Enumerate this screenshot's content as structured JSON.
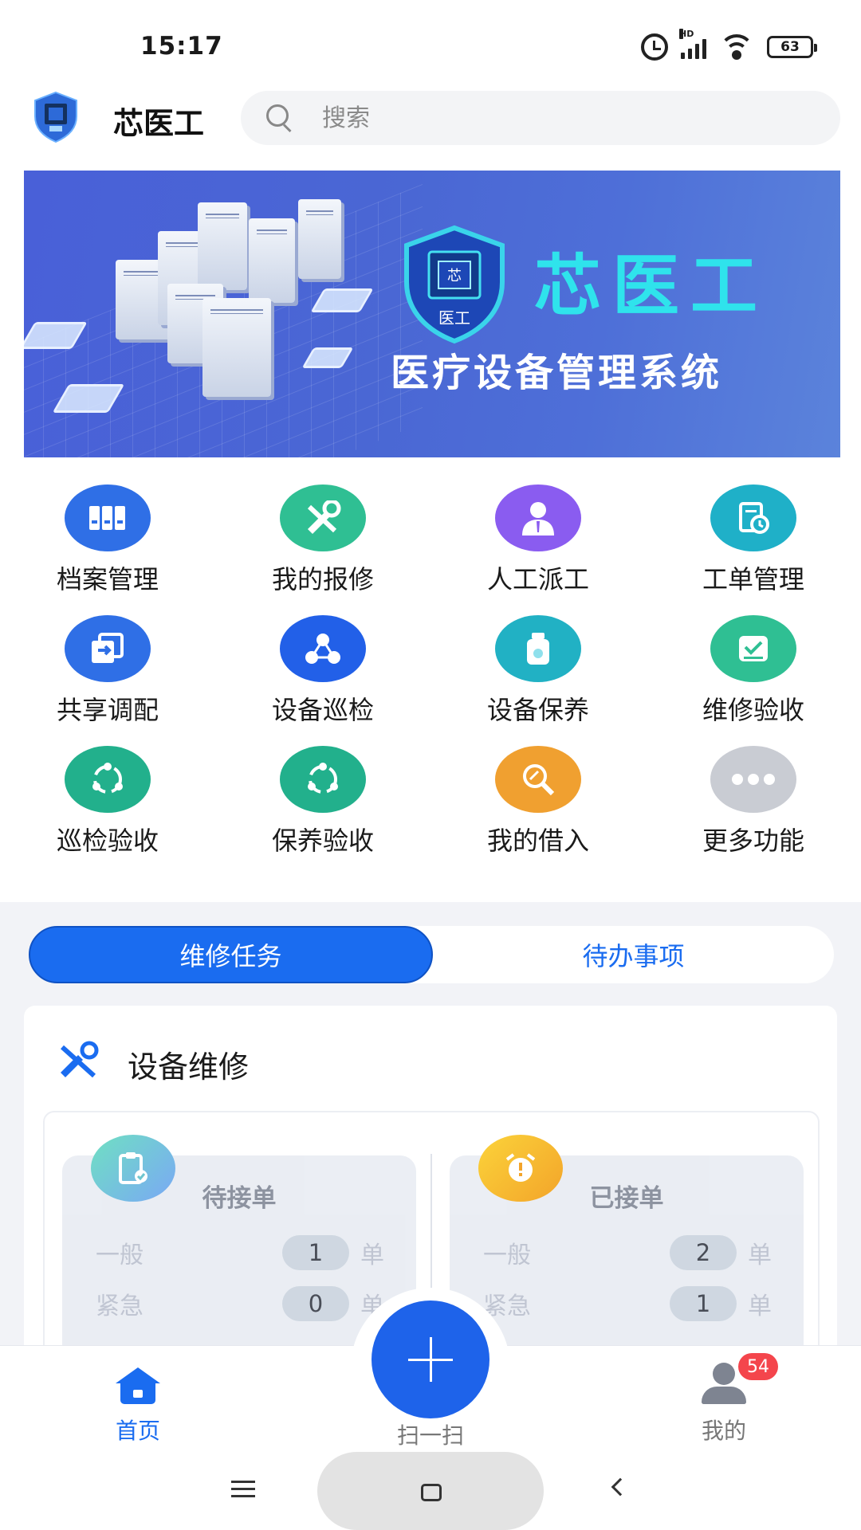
{
  "status_bar": {
    "time": "15:17",
    "battery": "63",
    "network": "HD"
  },
  "header": {
    "app_title": "芯医工",
    "search_placeholder": "搜索"
  },
  "banner": {
    "title": "芯医工",
    "subtitle": "医疗设备管理系统",
    "logo_char": "芯",
    "logo_text": "医工"
  },
  "features": [
    {
      "label": "档案管理",
      "icon": "archive-icon",
      "color": "#2f6fe6"
    },
    {
      "label": "我的报修",
      "icon": "tools-icon",
      "color": "#2fbf93"
    },
    {
      "label": "人工派工",
      "icon": "person-icon",
      "color": "#8a5cf0"
    },
    {
      "label": "工单管理",
      "icon": "work-order-icon",
      "color": "#1fb0c8"
    },
    {
      "label": "共享调配",
      "icon": "share-icon",
      "color": "#2f6fe6"
    },
    {
      "label": "设备巡检",
      "icon": "network-icon",
      "color": "#2260e8"
    },
    {
      "label": "设备保养",
      "icon": "bottle-icon",
      "color": "#21b1c4"
    },
    {
      "label": "维修验收",
      "icon": "check-icon",
      "color": "#2fbf93"
    },
    {
      "label": "巡检验收",
      "icon": "cycle-icon",
      "color": "#22b08c"
    },
    {
      "label": "保养验收",
      "icon": "cycle-icon",
      "color": "#22b08c"
    },
    {
      "label": "我的借入",
      "icon": "magnifier-icon",
      "color": "#f0a030"
    },
    {
      "label": "更多功能",
      "icon": "more-icon",
      "color": "#c9ccd3"
    }
  ],
  "tabs": {
    "repair_tasks": "维修任务",
    "todo": "待办事项"
  },
  "card": {
    "title": "设备维修",
    "pending": {
      "title": "待接单",
      "rows": [
        {
          "label": "一般",
          "count": "1",
          "unit": "单"
        },
        {
          "label": "紧急",
          "count": "0",
          "unit": "单"
        }
      ]
    },
    "accepted": {
      "title": "已接单",
      "rows": [
        {
          "label": "一般",
          "count": "2",
          "unit": "单"
        },
        {
          "label": "紧急",
          "count": "1",
          "unit": "单"
        }
      ]
    }
  },
  "bottom_nav": {
    "home": "首页",
    "scan": "扫一扫",
    "me": "我的",
    "badge": "54"
  },
  "colors": {
    "primary": "#1a6cf0",
    "badge": "#f4454c"
  }
}
